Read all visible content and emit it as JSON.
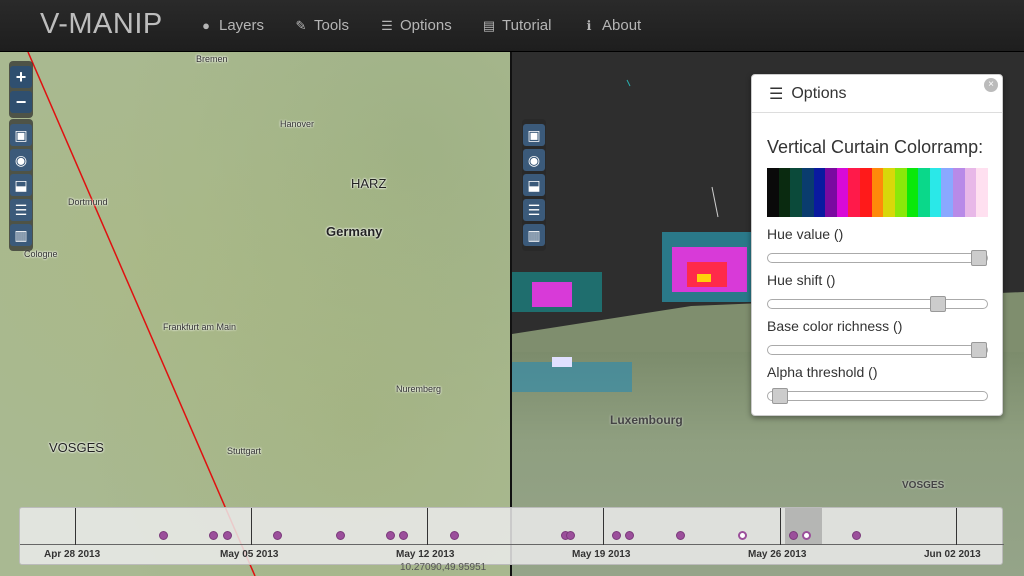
{
  "navbar": {
    "brand": "V-MANIP",
    "items": [
      {
        "label": "Layers",
        "icon": "globe-icon"
      },
      {
        "label": "Tools",
        "icon": "wrench-icon"
      },
      {
        "label": "Options",
        "icon": "list-icon"
      },
      {
        "label": "Tutorial",
        "icon": "book-icon"
      },
      {
        "label": "About",
        "icon": "info-icon"
      }
    ]
  },
  "map2d": {
    "labels": {
      "bremen": "Bremen",
      "hanover": "Hanover",
      "harz": "HARZ",
      "dortmund": "Dortmund",
      "germany": "Germany",
      "cologne": "Cologne",
      "frankfurt": "Frankfurt am Main",
      "nuremberg": "Nuremberg",
      "vosges": "VOSGES",
      "stuttgart": "Stuttgart"
    },
    "controls": [
      "zoom-in",
      "zoom-out",
      "image-layer",
      "globe-view",
      "inbox",
      "list",
      "chart"
    ]
  },
  "map3d": {
    "labels": {
      "luxembourg": "Luxembourg",
      "vosges": "VOSGES"
    }
  },
  "options": {
    "header": "Options",
    "close": "×",
    "colorramp_title": "Vertical Curtain Colorramp:",
    "ramp_colors": [
      "#0a0a0a",
      "#0a2a10",
      "#0b4a3a",
      "#0a3c6e",
      "#0a1aa0",
      "#7a0aa0",
      "#d80ad8",
      "#ff1a4a",
      "#ff1a1a",
      "#ff8a0a",
      "#d8d80a",
      "#8ae80a",
      "#0ae80a",
      "#0ad88a",
      "#2ae8e8",
      "#8aa8ff",
      "#b88ae8",
      "#e8b8e8",
      "#ffe0f0"
    ],
    "sliders": [
      {
        "label": "Hue value ()",
        "value": 1.0
      },
      {
        "label": "Hue shift ()",
        "value": 0.8
      },
      {
        "label": "Base color richness ()",
        "value": 1.0
      },
      {
        "label": "Alpha threshold ()",
        "value": 0.02
      }
    ]
  },
  "timeline": {
    "labels": [
      "Apr 28 2013",
      "May 05 2013",
      "May 12 2013",
      "May 19 2013",
      "May 26 2013",
      "Jun 02 2013"
    ]
  },
  "coordinates": "10.27090,49.95951"
}
